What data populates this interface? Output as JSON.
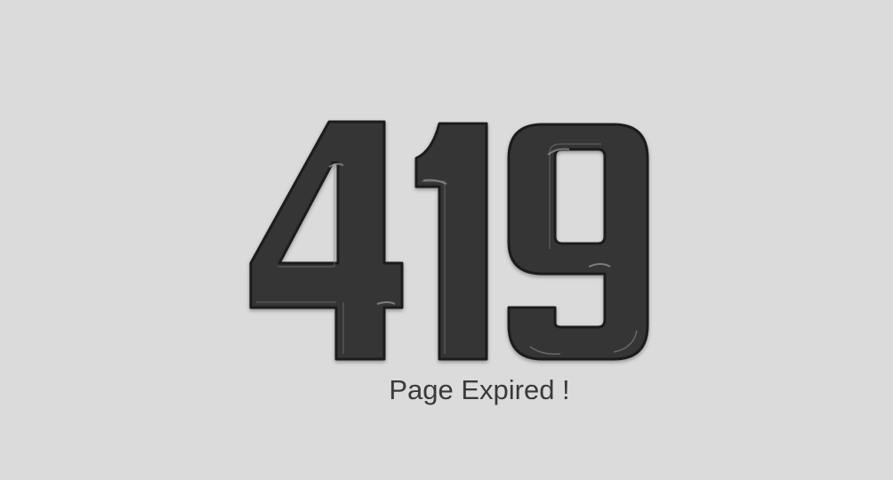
{
  "error": {
    "code": "419",
    "message": "Page Expired !"
  },
  "colors": {
    "background": "#dbdbdb",
    "digit_fill": "#353535",
    "digit_outline": "#1e1e1e",
    "digit_highlight": "#8a8a8a",
    "message": "#3a3a3a"
  }
}
